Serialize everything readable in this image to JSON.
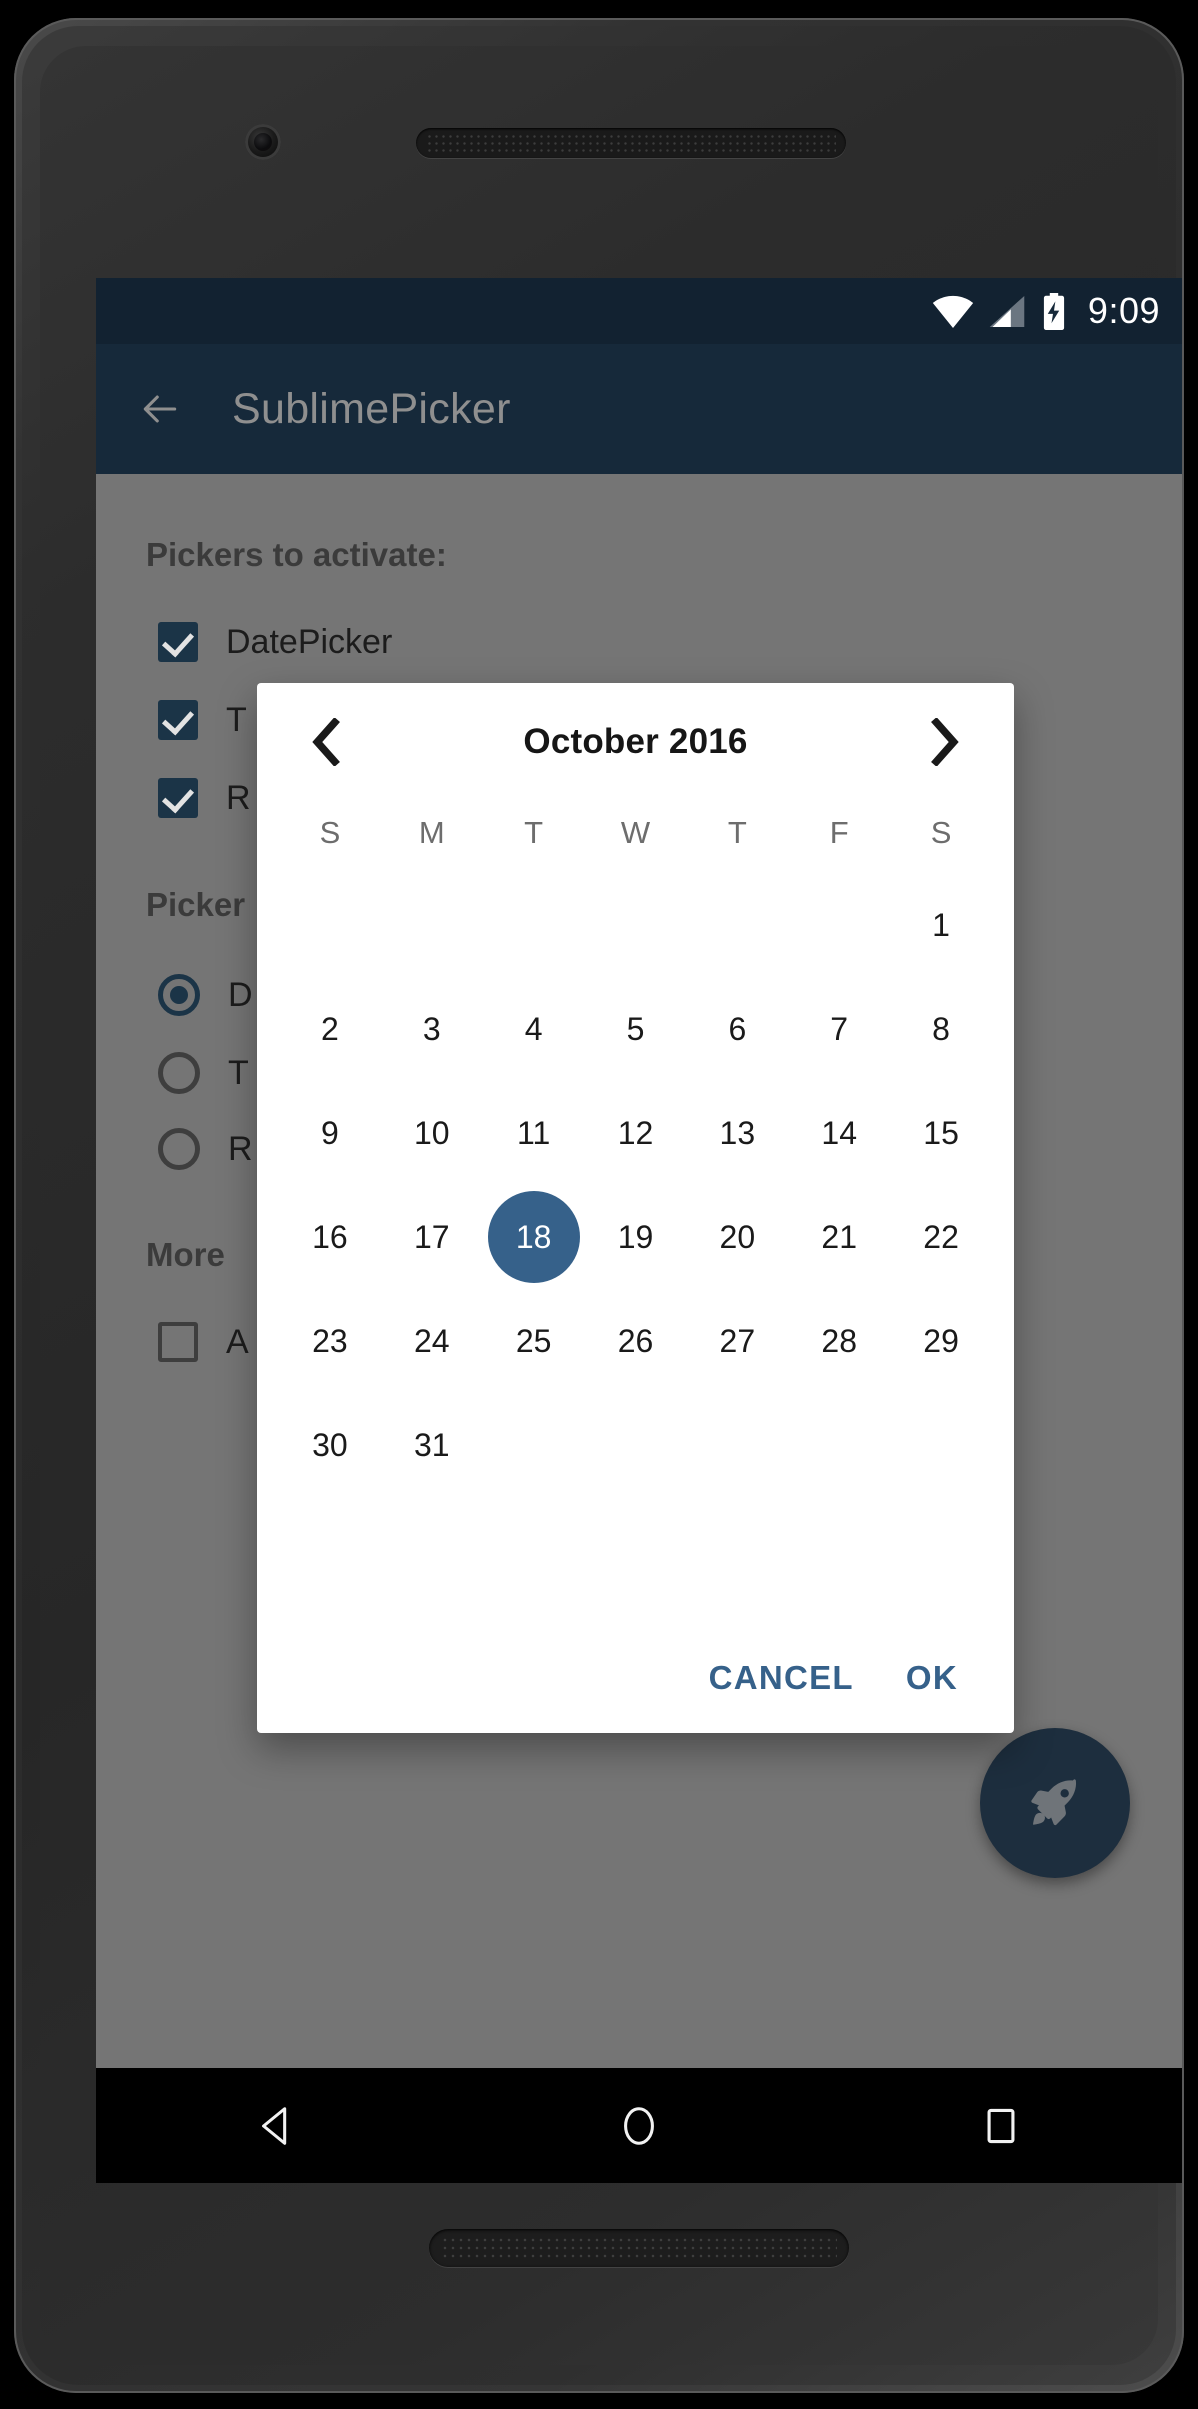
{
  "status_bar": {
    "time": "9:09",
    "icons": [
      "wifi-icon",
      "cellular-signal-icon",
      "battery-charging-icon"
    ]
  },
  "app_bar": {
    "back_label": "back-arrow-icon",
    "title": "SublimePicker"
  },
  "activity": {
    "sections": [
      {
        "heading": "Pickers to activate:"
      },
      {
        "heading": "Picker"
      },
      {
        "heading": "More"
      }
    ],
    "checkboxes": [
      {
        "label": "DatePicker",
        "checked": true
      },
      {
        "label": "T",
        "checked": true
      },
      {
        "label": "R",
        "checked": true
      }
    ],
    "radios": [
      {
        "label": "D",
        "selected": true
      },
      {
        "label": "T",
        "selected": false
      },
      {
        "label": "R",
        "selected": false
      }
    ],
    "more_checkbox": {
      "label": "A",
      "checked": false
    },
    "fab": {
      "icon": "rocket-icon"
    }
  },
  "dialog": {
    "month_year": "October 2016",
    "prev_icon": "chevron-left-icon",
    "next_icon": "chevron-right-icon",
    "weekdays": [
      "S",
      "M",
      "T",
      "W",
      "T",
      "F",
      "S"
    ],
    "leading_blanks": 6,
    "days": [
      1,
      2,
      3,
      4,
      5,
      6,
      7,
      8,
      9,
      10,
      11,
      12,
      13,
      14,
      15,
      16,
      17,
      18,
      19,
      20,
      21,
      22,
      23,
      24,
      25,
      26,
      27,
      28,
      29,
      30,
      31
    ],
    "selected_day": 18,
    "cancel_label": "CANCEL",
    "ok_label": "OK",
    "accent_color": "#36618a"
  },
  "nav_bar": {
    "back": "nav-back-icon",
    "home": "nav-home-icon",
    "recents": "nav-recents-icon"
  },
  "colors": {
    "status_bar_bg": "#122231",
    "app_bar_bg": "#16293a",
    "scrim": "#757575",
    "accent": "#36618a",
    "fab_bg": "#1d2e3e"
  }
}
